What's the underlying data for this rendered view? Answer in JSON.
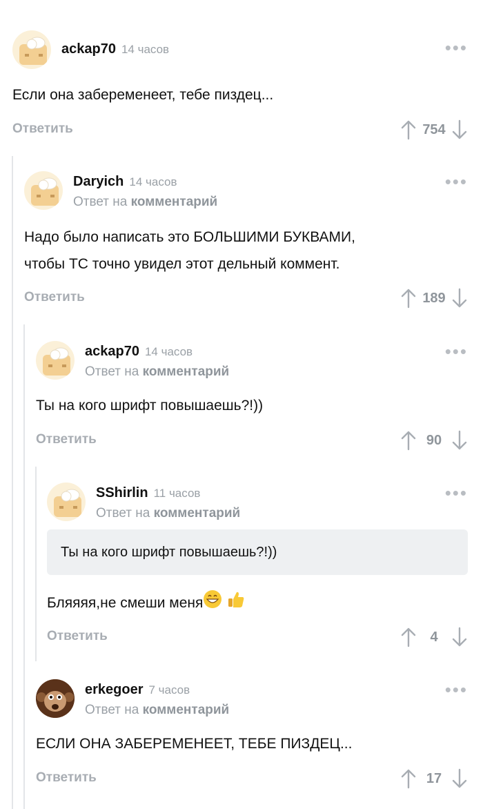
{
  "common": {
    "reply_label": "Ответить",
    "reply_to_prefix": "Ответ на",
    "reply_to_link": "комментарий",
    "menu_icon": "more-horizontal-icon",
    "upvote_icon": "arrow-up-icon",
    "downvote_icon": "arrow-down-icon"
  },
  "comments": [
    {
      "username": "ackap70",
      "time": "14 часов",
      "avatar": "chef-hat-avatar",
      "text": "Если она забеременеет, тебе пиздец...",
      "score": "754"
    },
    {
      "username": "Daryich",
      "time": "14 часов",
      "avatar": "chef-hat-avatar",
      "text_line1": "Надо было написать это БОЛЬШИМИ БУКВАМИ,",
      "text_line2": "чтобы ТС точно увидел этот дельный коммент.",
      "score": "189"
    },
    {
      "username": "ackap70",
      "time": "14 часов",
      "avatar": "chef-hat-avatar",
      "text": "Ты на кого шрифт повышаешь?!))",
      "score": "90"
    },
    {
      "username": "SShirlin",
      "time": "11 часов",
      "avatar": "chef-hat-avatar",
      "quote": "Ты на кого шрифт повышаешь?!))",
      "text": "Бляяяя,не смеши меня",
      "emojis": [
        "grinning-face-emoji",
        "thumbs-up-emoji"
      ],
      "score": "4"
    },
    {
      "username": "erkegoer",
      "time": "7 часов",
      "avatar": "monkey-avatar",
      "text": "ЕСЛИ ОНА ЗАБЕРЕМЕНЕЕТ, ТЕБЕ ПИЗДЕЦ...",
      "score": "17"
    }
  ],
  "colors": {
    "muted": "#9aa0a6",
    "thread_line": "#e3e5e8",
    "quote_bg": "#eef0f2"
  }
}
